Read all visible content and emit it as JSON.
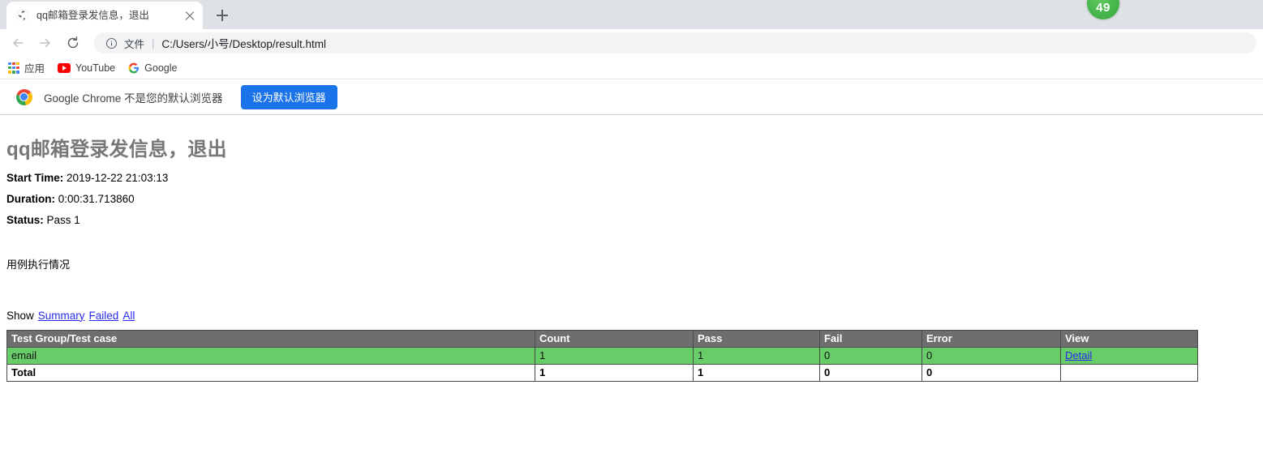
{
  "browser": {
    "tab": {
      "title": "qq邮箱登录发信息，退出",
      "favicon": "globe-icon",
      "close": "close-icon"
    },
    "new_tab_label": "+",
    "badge": {
      "count": "49",
      "color": "#3faf46"
    },
    "nav": {
      "back": "back-arrow-icon",
      "forward": "forward-arrow-icon",
      "reload": "reload-icon"
    },
    "omnibox": {
      "info_icon": "info-circle-icon",
      "scheme_label": "文件",
      "separator": "|",
      "url": "C:/Users/小号/Desktop/result.html"
    },
    "bookmarks": [
      {
        "label": "应用",
        "icon": "apps-grid-icon"
      },
      {
        "label": "YouTube",
        "icon": "youtube-icon"
      },
      {
        "label": "Google",
        "icon": "google-g-icon"
      }
    ],
    "infobar": {
      "icon": "chrome-logo-icon",
      "message": "Google Chrome 不是您的默认浏览器",
      "button_label": "设为默认浏览器",
      "button_color": "#1a73e8"
    }
  },
  "report": {
    "title": "qq邮箱登录发信息，退出",
    "start_time_label": "Start Time:",
    "start_time_value": "2019-12-22 21:03:13",
    "duration_label": "Duration:",
    "duration_value": "0:00:31.713860",
    "status_label": "Status:",
    "status_value": "Pass 1",
    "description": "用例执行情况",
    "show_label": "Show",
    "show_links": [
      "Summary",
      "Failed",
      "All"
    ],
    "table": {
      "headers": [
        "Test Group/Test case",
        "Count",
        "Pass",
        "Fail",
        "Error",
        "View"
      ],
      "header_bg": "#6e6e6e",
      "pass_row_bg": "#68cc68",
      "rows": [
        {
          "name": "email",
          "count": "1",
          "pass": "1",
          "fail": "0",
          "error": "0",
          "view": "Detail",
          "status": "pass"
        }
      ],
      "total": {
        "name": "Total",
        "count": "1",
        "pass": "1",
        "fail": "0",
        "error": "0",
        "view": ""
      }
    }
  }
}
